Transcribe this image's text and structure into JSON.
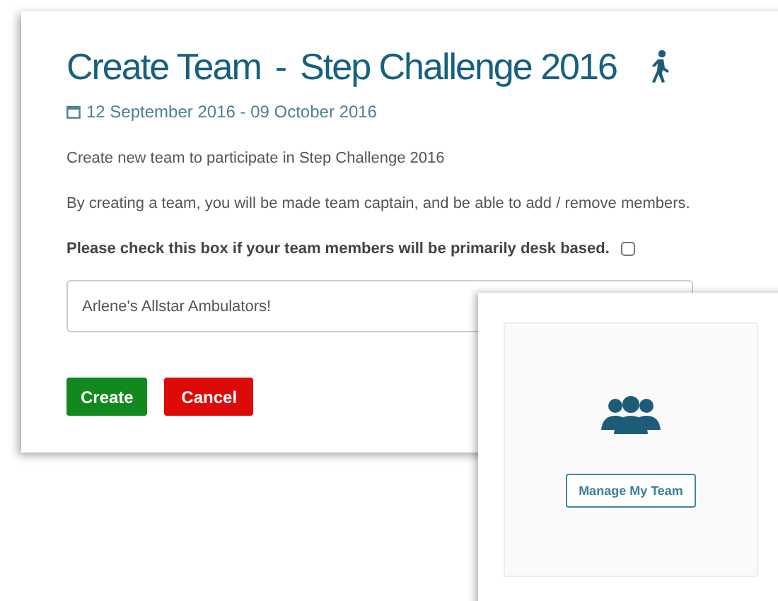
{
  "title": "Create Team",
  "separator": "-",
  "challenge": "Step Challenge 2016",
  "date_range": "12 September 2016 - 09 October 2016",
  "intro": "Create new team to participate in Step Challenge 2016",
  "info": "By creating a team, you will be made team captain, and be able to add / remove members.",
  "desk_checkbox": {
    "label": "Please check this box if your team members will be primarily desk based.",
    "checked": false
  },
  "team_name": {
    "value": "Arlene's Allstar Ambulators!"
  },
  "buttons": [
    {
      "label": "Create",
      "kind": "primary"
    },
    {
      "label": "Cancel",
      "kind": "danger"
    }
  ],
  "side_card": {
    "button": "Manage My Team"
  }
}
